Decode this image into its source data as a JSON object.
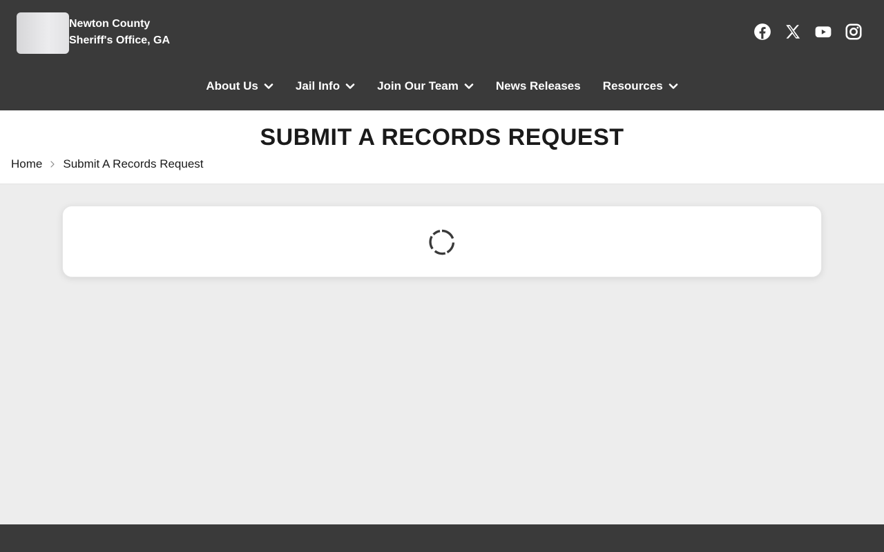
{
  "site": {
    "name_line1": "Newton County",
    "name_line2": "Sheriff's Office, GA"
  },
  "socials": [
    {
      "name": "facebook",
      "icon": "facebook-icon"
    },
    {
      "name": "x",
      "icon": "x-icon"
    },
    {
      "name": "youtube",
      "icon": "youtube-icon"
    },
    {
      "name": "instagram",
      "icon": "instagram-icon"
    }
  ],
  "nav": {
    "items": [
      {
        "label": "About Us",
        "has_dropdown": true
      },
      {
        "label": "Jail Info",
        "has_dropdown": true
      },
      {
        "label": "Join Our Team",
        "has_dropdown": true
      },
      {
        "label": "News Releases",
        "has_dropdown": false
      },
      {
        "label": "Resources",
        "has_dropdown": true
      }
    ]
  },
  "page": {
    "title": "SUBMIT A RECORDS REQUEST"
  },
  "breadcrumb": {
    "home": "Home",
    "current": "Submit A Records Request"
  },
  "colors": {
    "header_bg": "#3a3a3a",
    "body_bg": "#ededed",
    "text": "#1a1a1a"
  }
}
